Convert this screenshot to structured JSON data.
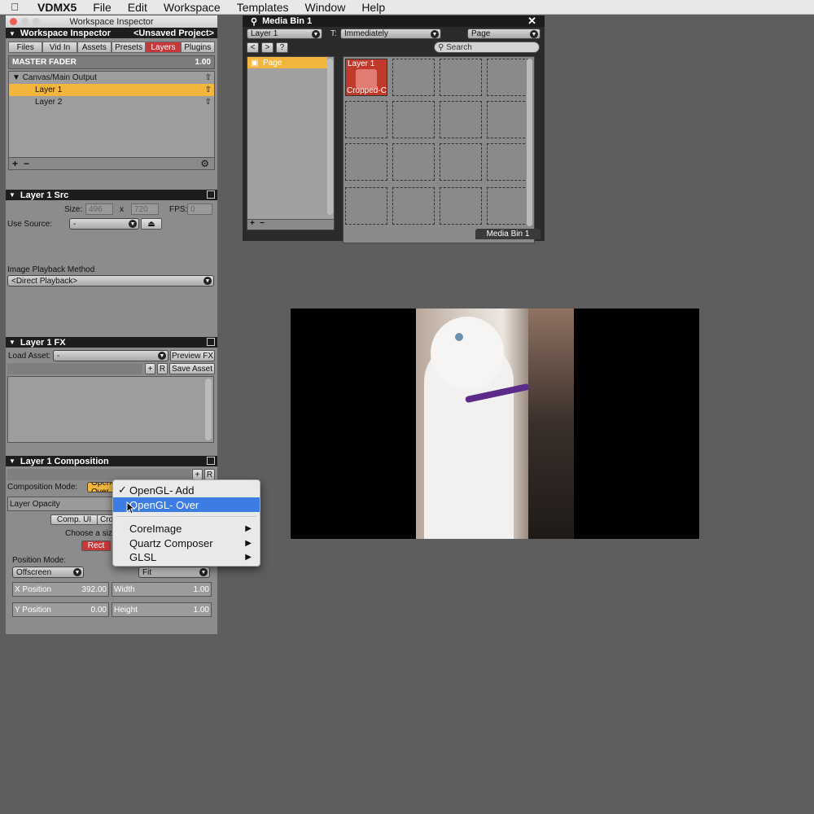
{
  "menubar": {
    "app": "VDMX5",
    "items": [
      "File",
      "Edit",
      "Workspace",
      "Templates",
      "Window",
      "Help"
    ]
  },
  "inspector": {
    "window_title": "Workspace Inspector",
    "header": "Workspace Inspector",
    "project": "<Unsaved Project>",
    "tabs": [
      "Files",
      "Vid In",
      "Assets",
      "Presets",
      "Layers",
      "Plugins"
    ],
    "active_tab": "Layers",
    "master_fader": {
      "label": "MASTER FADER",
      "value": "1.00"
    },
    "tree": {
      "root": "Canvas/Main Output",
      "layers": [
        "Layer 1",
        "Layer 2"
      ],
      "selected": "Layer 1"
    }
  },
  "src": {
    "title": "Layer 1 Src",
    "size_label": "Size:",
    "width": "496",
    "x_label": "x",
    "height": "720",
    "fps_label": "FPS:",
    "fps": "0",
    "use_source_label": "Use Source:",
    "use_source_value": "-",
    "playback_label": "Image Playback Method",
    "playback_value": "<Direct Playback>"
  },
  "fx": {
    "title": "Layer 1 FX",
    "load_asset_label": "Load Asset:",
    "load_asset_value": "-",
    "preview_label": "Preview FX",
    "save_label": "Save Asset",
    "add": "+",
    "r": "R"
  },
  "comp": {
    "title": "Layer 1 Composition",
    "mode_label": "Composition Mode:",
    "mode_value": "OpenGL- Over",
    "opacity_label": "Layer Opacity",
    "comp_ui_tab": "Comp. UI",
    "crop_tab": "Cro",
    "choose_text": "Choose a siz",
    "rect_btn": "Rect",
    "position_mode_label": "Position Mode:",
    "position_mode_value": "Offscreen",
    "fit_value": "Fit",
    "x_label": "X Position",
    "x_value": "392.00",
    "y_label": "Y Position",
    "y_value": "0.00",
    "w_label": "Width",
    "w_value": "1.00",
    "h_label": "Height",
    "h_value": "1.00",
    "add": "+",
    "r": "R"
  },
  "dropdown": {
    "items": [
      {
        "label": "OpenGL- Add",
        "checked": true
      },
      {
        "label": "OpenGL- Over",
        "highlighted": true
      },
      {
        "label": "CoreImage",
        "submenu": true
      },
      {
        "label": "Quartz Composer",
        "submenu": true
      },
      {
        "label": "GLSL",
        "submenu": true
      }
    ]
  },
  "mediabin": {
    "title": "Media Bin 1",
    "layer_select": "Layer 1",
    "t_label": "T:",
    "trigger_select": "Immediately",
    "page_select": "Page",
    "search_placeholder": "Search",
    "nav": [
      "<",
      ">",
      "?"
    ],
    "page_item": "Page",
    "clip_layer": "Layer 1",
    "clip_name": "Cropped-Ca",
    "tab_label": "Media Bin 1"
  },
  "colors": {
    "accent_red": "#c8383a",
    "selection_orange": "#f2b63c",
    "menu_highlight": "#3d7ce2"
  }
}
